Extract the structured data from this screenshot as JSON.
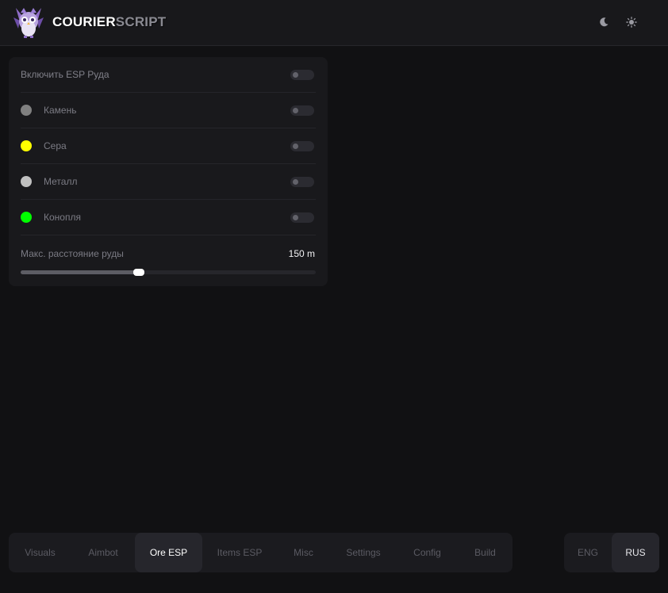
{
  "header": {
    "brand_primary": "COURIER",
    "brand_secondary": "SCRIPT",
    "logo_icon": "owl-logo-icon",
    "theme_dark_icon": "moon-icon",
    "theme_light_icon": "sun-icon"
  },
  "ore_panel": {
    "enable_label": "Включить ESP Руда",
    "items": [
      {
        "label": "Камень",
        "color": "#808080"
      },
      {
        "label": "Сера",
        "color": "#ffff00"
      },
      {
        "label": "Металл",
        "color": "#c0c0c0"
      },
      {
        "label": "Конопля",
        "color": "#00ff00"
      }
    ],
    "distance_label": "Макс. расстояние руды",
    "distance_value": "150 m",
    "distance_fraction": 0.4
  },
  "tabs": {
    "items": [
      "Visuals",
      "Aimbot",
      "Ore ESP",
      "Items ESP",
      "Misc",
      "Settings",
      "Config",
      "Build"
    ],
    "active": "Ore ESP"
  },
  "language": {
    "options": [
      "ENG",
      "RUS"
    ],
    "active": "RUS"
  }
}
